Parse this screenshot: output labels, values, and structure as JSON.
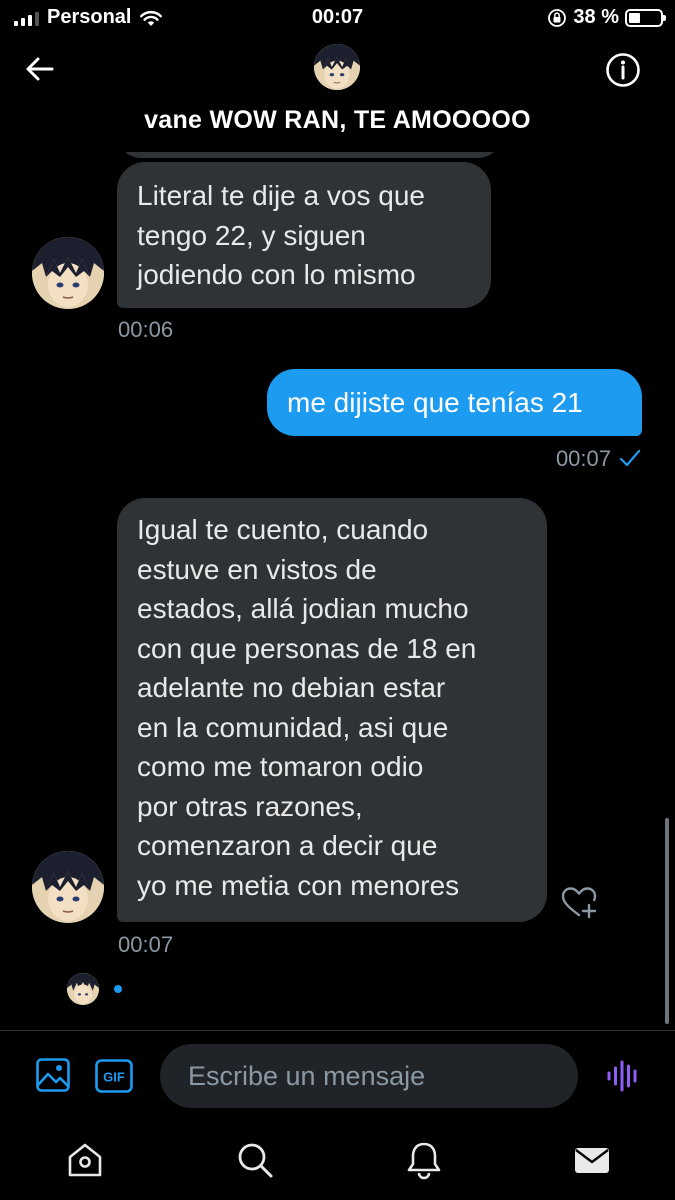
{
  "status_bar": {
    "carrier": "Personal",
    "time": "00:07",
    "battery_percent": "38 %",
    "battery_level": 0.38,
    "icons": [
      "signal-icon",
      "wifi-icon",
      "rotation-lock-icon",
      "battery-icon"
    ]
  },
  "header": {
    "title": "vane WOW RAN, TE AMOOOOO",
    "icons": [
      "back-arrow-icon",
      "info-icon"
    ]
  },
  "messages": [
    {
      "direction": "incoming",
      "lines": [
        "Literal te dije a vos que",
        "tengo 22, y siguen",
        "jodiendo con lo mismo"
      ],
      "time": "00:06"
    },
    {
      "direction": "outgoing",
      "lines": [
        "me dijiste que tenías 21"
      ],
      "time": "00:07",
      "status_icon": "sent-check-icon"
    },
    {
      "direction": "incoming",
      "lines": [
        "Igual te cuento, cuando",
        "estuve en vistos de",
        "estados, allá jodian mucho",
        "con que personas de 18 en",
        "adelante no debian estar",
        "en la comunidad, asi que",
        "como me tomaron odio",
        "por otras razones,",
        "comenzaron a decir que",
        "yo me metia con menores"
      ],
      "time": "00:07",
      "reaction_icon": "heart-plus-icon"
    }
  ],
  "composer": {
    "placeholder": "Escribe un mensaje",
    "media_icon": "image-icon",
    "gif_label": "GIF",
    "voice_icon": "voice-waveform-icon"
  },
  "tabbar": {
    "items": [
      "home-icon",
      "search-icon",
      "bell-icon",
      "envelope-icon"
    ]
  },
  "colors": {
    "background": "#000000",
    "incoming_bubble": "#2f3336",
    "outgoing_bubble": "#1d9bf0",
    "timestamp": "#8b98a5",
    "voice_accent": "#8e5cf7"
  }
}
